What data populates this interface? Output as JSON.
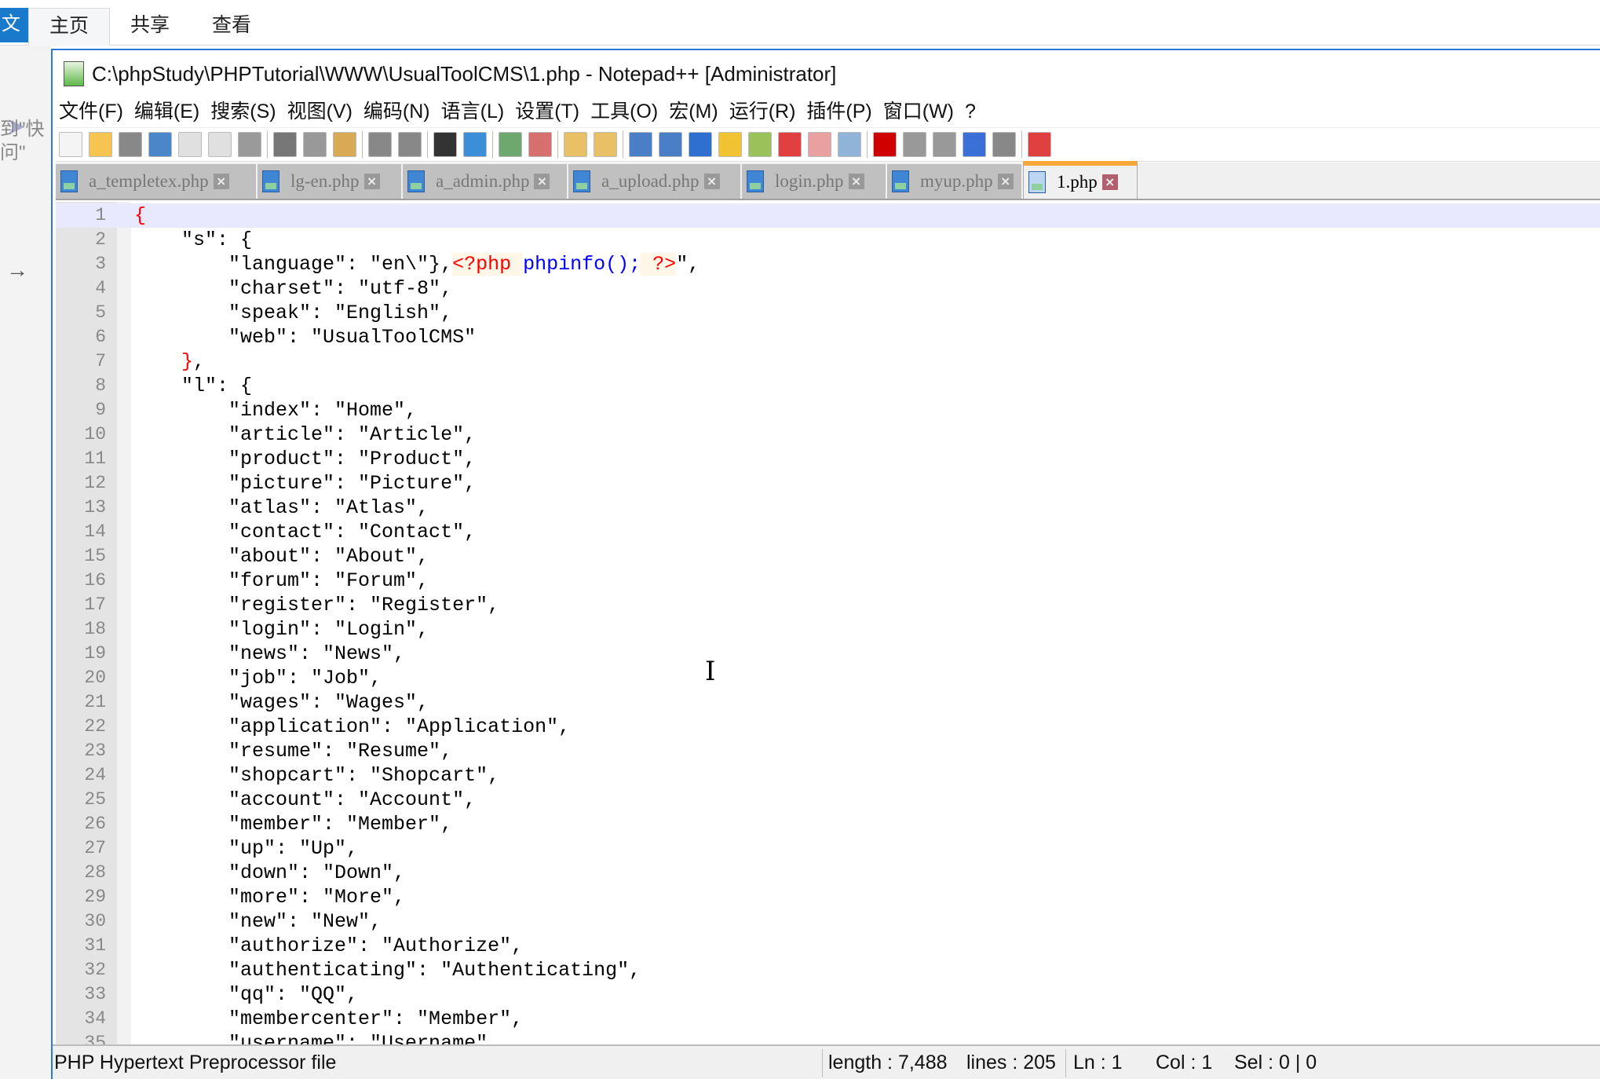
{
  "ribbon": {
    "file_label": "文",
    "tabs": [
      "主页",
      "共享",
      "查看"
    ]
  },
  "explorer": {
    "fragment1": "到\"快",
    "fragment2": "问\""
  },
  "window": {
    "title": "C:\\phpStudy\\PHPTutorial\\WWW\\UsualToolCMS\\1.php - Notepad++ [Administrator]"
  },
  "menu": [
    "文件(F)",
    "编辑(E)",
    "搜索(S)",
    "视图(V)",
    "编码(N)",
    "语言(L)",
    "设置(T)",
    "工具(O)",
    "宏(M)",
    "运行(R)",
    "插件(P)",
    "窗口(W)",
    "?"
  ],
  "toolbar": [
    {
      "name": "new-file-icon",
      "color": "#f4f4f4"
    },
    {
      "name": "open-file-icon",
      "color": "#f5c451"
    },
    {
      "name": "save-icon",
      "color": "#888888"
    },
    {
      "name": "save-all-icon",
      "color": "#4a86c8"
    },
    {
      "name": "close-icon",
      "color": "#e0e0e0"
    },
    {
      "name": "close-all-icon",
      "color": "#e0e0e0"
    },
    {
      "name": "print-icon",
      "color": "#9a9a9a"
    },
    "|",
    {
      "name": "cut-icon",
      "color": "#777777"
    },
    {
      "name": "copy-icon",
      "color": "#999999"
    },
    {
      "name": "paste-icon",
      "color": "#d9a955"
    },
    "|",
    {
      "name": "undo-icon",
      "color": "#888888"
    },
    {
      "name": "redo-icon",
      "color": "#888888"
    },
    "|",
    {
      "name": "find-icon",
      "color": "#333333"
    },
    {
      "name": "replace-icon",
      "color": "#3a8fd8"
    },
    "|",
    {
      "name": "zoom-in-icon",
      "color": "#6fa86f"
    },
    {
      "name": "zoom-out-icon",
      "color": "#d86f6f"
    },
    "|",
    {
      "name": "sync-vertical-icon",
      "color": "#e9c066"
    },
    {
      "name": "sync-horizontal-icon",
      "color": "#e9c066"
    },
    "|",
    {
      "name": "word-wrap-icon",
      "color": "#4a7fc8"
    },
    {
      "name": "show-all-chars-icon",
      "color": "#4a7fc8"
    },
    {
      "name": "indent-guide-icon",
      "color": "#2f6fd0"
    },
    {
      "name": "udl-icon",
      "color": "#f1c231"
    },
    {
      "name": "doc-map-icon",
      "color": "#9bc25a"
    },
    {
      "name": "function-list-icon",
      "color": "#e04040"
    },
    {
      "name": "folder-workspace-icon",
      "color": "#e8a0a0"
    },
    {
      "name": "monitoring-icon",
      "color": "#8fb4d8"
    },
    "|",
    {
      "name": "record-macro-icon",
      "color": "#d00000"
    },
    {
      "name": "stop-macro-icon",
      "color": "#999999"
    },
    {
      "name": "play-macro-icon",
      "color": "#999999"
    },
    {
      "name": "run-macro-multiple-icon",
      "color": "#3a70d8"
    },
    {
      "name": "save-macro-icon",
      "color": "#888888"
    },
    "|",
    {
      "name": "spell-check-icon",
      "color": "#e04040"
    }
  ],
  "tabs": [
    {
      "label": "a_templetex.php",
      "active": false
    },
    {
      "label": "lg-en.php",
      "active": false
    },
    {
      "label": "a_admin.php",
      "active": false
    },
    {
      "label": "a_upload.php",
      "active": false
    },
    {
      "label": "login.php",
      "active": false
    },
    {
      "label": "myup.php",
      "active": false
    },
    {
      "label": "1.php",
      "active": true
    }
  ],
  "code_lines": [
    [
      {
        "t": "{",
        "s": "brace"
      }
    ],
    [
      {
        "t": "    \"s\": {"
      }
    ],
    [
      {
        "t": "        \"language\": \"en\\\"},"
      },
      {
        "t": "<?php",
        "s": "php"
      },
      {
        "t": " ",
        "s": "php"
      },
      {
        "t": "phpinfo",
        "s": "fn"
      },
      {
        "t": "();",
        "s": "pun"
      },
      {
        "t": " ",
        "s": "php"
      },
      {
        "t": "?>",
        "s": "php"
      },
      {
        "t": "\","
      }
    ],
    [
      {
        "t": "        \"charset\": \"utf-8\","
      }
    ],
    [
      {
        "t": "        \"speak\": \"English\","
      }
    ],
    [
      {
        "t": "        \"web\": \"UsualToolCMS\""
      }
    ],
    [
      {
        "t": "    "
      },
      {
        "t": "}",
        "s": "brace"
      },
      {
        "t": ","
      }
    ],
    [
      {
        "t": "    \"l\": {"
      }
    ],
    [
      {
        "t": "        \"index\": \"Home\","
      }
    ],
    [
      {
        "t": "        \"article\": \"Article\","
      }
    ],
    [
      {
        "t": "        \"product\": \"Product\","
      }
    ],
    [
      {
        "t": "        \"picture\": \"Picture\","
      }
    ],
    [
      {
        "t": "        \"atlas\": \"Atlas\","
      }
    ],
    [
      {
        "t": "        \"contact\": \"Contact\","
      }
    ],
    [
      {
        "t": "        \"about\": \"About\","
      }
    ],
    [
      {
        "t": "        \"forum\": \"Forum\","
      }
    ],
    [
      {
        "t": "        \"register\": \"Register\","
      }
    ],
    [
      {
        "t": "        \"login\": \"Login\","
      }
    ],
    [
      {
        "t": "        \"news\": \"News\","
      }
    ],
    [
      {
        "t": "        \"job\": \"Job\","
      }
    ],
    [
      {
        "t": "        \"wages\": \"Wages\","
      }
    ],
    [
      {
        "t": "        \"application\": \"Application\","
      }
    ],
    [
      {
        "t": "        \"resume\": \"Resume\","
      }
    ],
    [
      {
        "t": "        \"shopcart\": \"Shopcart\","
      }
    ],
    [
      {
        "t": "        \"account\": \"Account\","
      }
    ],
    [
      {
        "t": "        \"member\": \"Member\","
      }
    ],
    [
      {
        "t": "        \"up\": \"Up\","
      }
    ],
    [
      {
        "t": "        \"down\": \"Down\","
      }
    ],
    [
      {
        "t": "        \"more\": \"More\","
      }
    ],
    [
      {
        "t": "        \"new\": \"New\","
      }
    ],
    [
      {
        "t": "        \"authorize\": \"Authorize\","
      }
    ],
    [
      {
        "t": "        \"authenticating\": \"Authenticating\","
      }
    ],
    [
      {
        "t": "        \"qq\": \"QQ\","
      }
    ],
    [
      {
        "t": "        \"membercenter\": \"Member\","
      }
    ],
    [
      {
        "t": "        \"username\": \"Username\""
      }
    ]
  ],
  "status": {
    "file_type": "PHP Hypertext Preprocessor file",
    "length": "length : 7,488",
    "lines": "lines : 205",
    "ln": "Ln : 1",
    "col": "Col : 1",
    "sel": "Sel : 0 | 0"
  }
}
